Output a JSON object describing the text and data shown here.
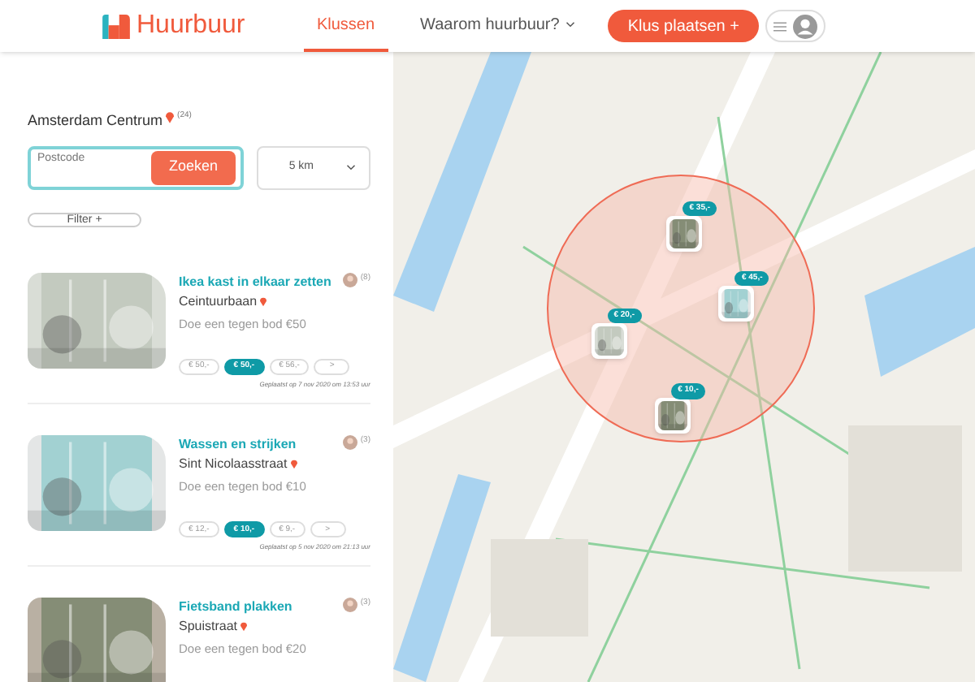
{
  "header": {
    "logo": "Huurbuur",
    "nav": [
      {
        "label": "Klussen",
        "selected": true
      },
      {
        "label": "Waarom huurbuur?",
        "selected": false
      }
    ],
    "cta": "Klus plaatsen +"
  },
  "location": {
    "label": "Amsterdam Centrum",
    "count": "(24)"
  },
  "search": {
    "placeholder": "Postcode",
    "button": "Zoeken"
  },
  "distance": "5 km",
  "filter": "Filter +",
  "jobs": [
    {
      "title": "Ikea kast in elkaar zetten",
      "street": "Ceintuurbaan",
      "offer": "Doe een tegen bod €50",
      "count": "(8)",
      "bids": [
        {
          "label": "€ 50,-",
          "selected": false
        },
        {
          "label": "€ 50,-",
          "selected": true
        },
        {
          "label": "€ 56,-",
          "selected": false
        },
        {
          "label": ">",
          "selected": false
        }
      ],
      "posted": "Geplaatst op 7 nov 2020 om 13:53 uur"
    },
    {
      "title": "Wassen en strijken",
      "street": "Sint Nicolaasstraat",
      "offer": "Doe een tegen bod €10",
      "count": "(3)",
      "bids": [
        {
          "label": "€ 12,-",
          "selected": false
        },
        {
          "label": "€ 10,-",
          "selected": true
        },
        {
          "label": "€ 9,-",
          "selected": false
        },
        {
          "label": ">",
          "selected": false
        }
      ],
      "posted": "Geplaatst op 5 nov 2020 om 21:13 uur"
    },
    {
      "title": "Fietsband plakken",
      "street": "Spuistraat",
      "offer": "Doe een tegen bod €20",
      "count": "(3)"
    }
  ],
  "map_markers": [
    {
      "price": "€ 35,-"
    },
    {
      "price": "€ 45,-"
    },
    {
      "price": "€ 20,-"
    },
    {
      "price": "€ 10,-"
    }
  ]
}
